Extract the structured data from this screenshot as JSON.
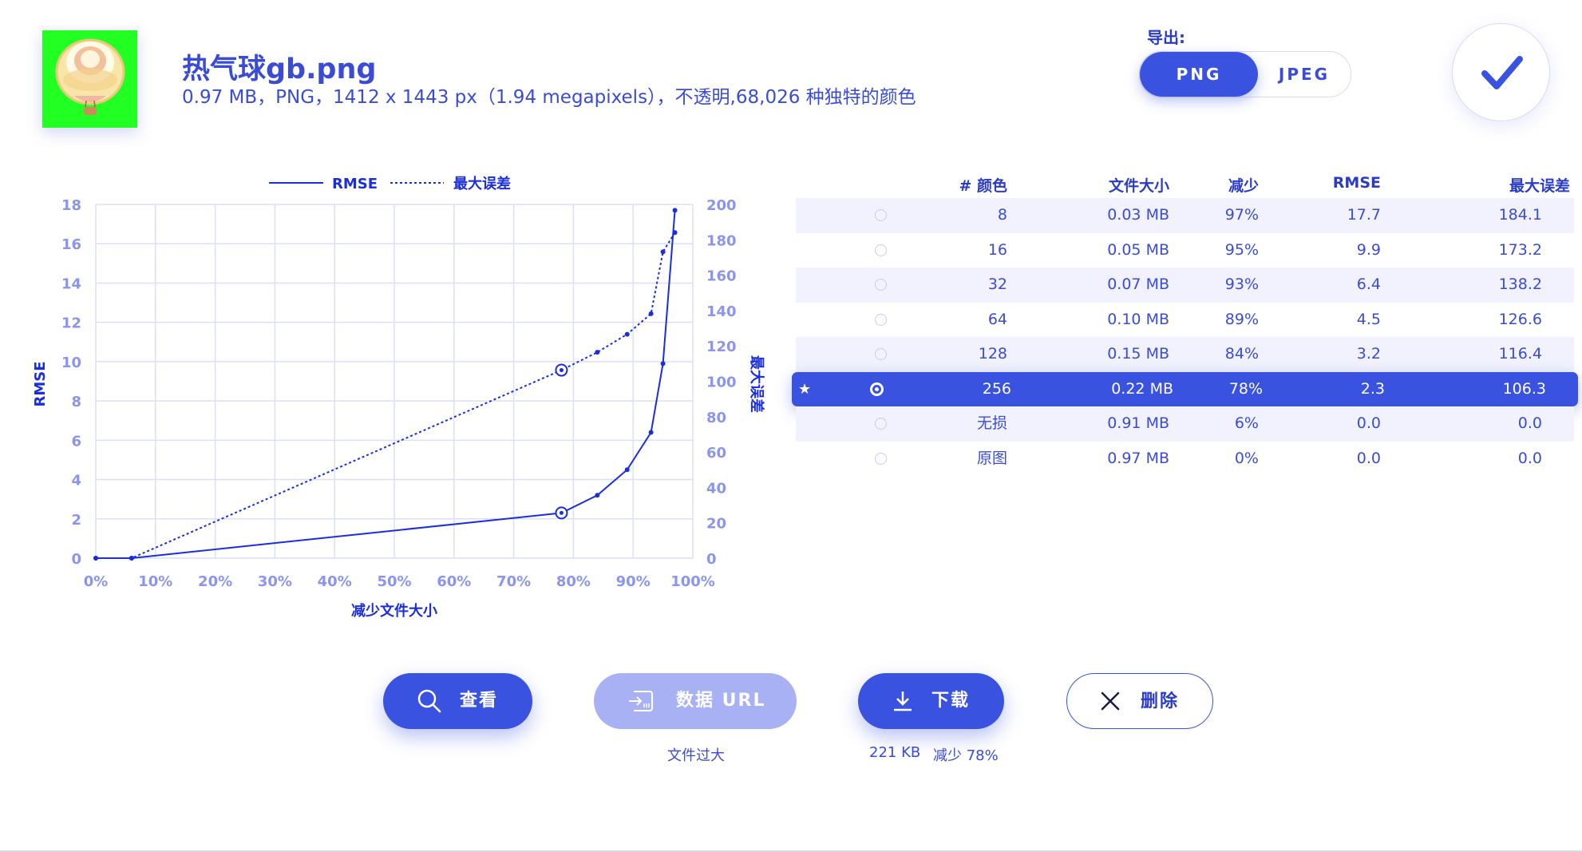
{
  "file": {
    "name": "热气球gb.png",
    "meta": "0.97 MB，PNG，1412 x 1443 px（1.94 megapixels），不透明,68,026 种独特的颜色",
    "thumbnail_icon": "hot-air-balloon-image"
  },
  "export": {
    "label": "导出:",
    "formats": [
      "PNG",
      "JPEG"
    ],
    "selected": "PNG",
    "confirm_icon": "checkmark-icon"
  },
  "chart_data": {
    "type": "line",
    "legend": [
      "RMSE",
      "最大误差"
    ],
    "legend_placement": "top",
    "xlabel": "减少文件大小",
    "ylabel": "RMSE",
    "y2label": "最大误差",
    "x_ticks": [
      "0%",
      "10%",
      "20%",
      "30%",
      "40%",
      "50%",
      "60%",
      "70%",
      "80%",
      "90%",
      "100%"
    ],
    "y_ticks": [
      "0",
      "2",
      "4",
      "6",
      "8",
      "10",
      "12",
      "14",
      "16",
      "18"
    ],
    "y2_ticks": [
      "0",
      "20",
      "40",
      "60",
      "80",
      "100",
      "120",
      "140",
      "160",
      "180",
      "200"
    ],
    "xlim": [
      0,
      100
    ],
    "ylim": [
      0,
      18
    ],
    "y2lim": [
      0,
      200
    ],
    "grid": true,
    "x": [
      0,
      6,
      78,
      84,
      89,
      93,
      95,
      97
    ],
    "series": [
      {
        "name": "RMSE",
        "axis": "left",
        "style": "solid",
        "values": [
          0.0,
          0.0,
          2.3,
          3.2,
          4.5,
          6.4,
          9.9,
          17.7
        ]
      },
      {
        "name": "最大误差",
        "axis": "right",
        "style": "dotted",
        "values": [
          0.0,
          0.0,
          106.3,
          116.4,
          126.6,
          138.2,
          173.2,
          184.1
        ]
      }
    ],
    "highlight_x": 78
  },
  "table": {
    "headers": [
      "# 颜色",
      "文件大小",
      "减少",
      "RMSE",
      "最大误差"
    ],
    "rows": [
      {
        "colors": "8",
        "size": "0.03 MB",
        "reduction": "97%",
        "rmse": "17.7",
        "max_error": "184.1",
        "selected": false
      },
      {
        "colors": "16",
        "size": "0.05 MB",
        "reduction": "95%",
        "rmse": "9.9",
        "max_error": "173.2",
        "selected": false
      },
      {
        "colors": "32",
        "size": "0.07 MB",
        "reduction": "93%",
        "rmse": "6.4",
        "max_error": "138.2",
        "selected": false
      },
      {
        "colors": "64",
        "size": "0.10 MB",
        "reduction": "89%",
        "rmse": "4.5",
        "max_error": "126.6",
        "selected": false
      },
      {
        "colors": "128",
        "size": "0.15 MB",
        "reduction": "84%",
        "rmse": "3.2",
        "max_error": "116.4",
        "selected": false
      },
      {
        "colors": "256",
        "size": "0.22 MB",
        "reduction": "78%",
        "rmse": "2.3",
        "max_error": "106.3",
        "selected": true,
        "mark": "★"
      },
      {
        "colors": "无损",
        "size": "0.91 MB",
        "reduction": "6%",
        "rmse": "0.0",
        "max_error": "0.0",
        "selected": false
      },
      {
        "colors": "原图",
        "size": "0.97 MB",
        "reduction": "0%",
        "rmse": "0.0",
        "max_error": "0.0",
        "selected": false
      }
    ]
  },
  "actions": {
    "view": {
      "label": "查看",
      "icon": "search-icon"
    },
    "data_url": {
      "label": "数据 URL",
      "icon": "import-icon",
      "note": "文件过大",
      "disabled": true
    },
    "download": {
      "label": "下载",
      "icon": "download-icon",
      "note_size": "221 KB",
      "note_reduction": "减少 78%"
    },
    "delete": {
      "label": "删除",
      "icon": "close-icon"
    }
  },
  "colors": {
    "accent": "#3a52e0",
    "accent_light": "#a7b1f3",
    "text": "#3a4cd6",
    "line": "#1a2ee0",
    "grid": "#dcdffa",
    "tick": "#8b95ee"
  }
}
